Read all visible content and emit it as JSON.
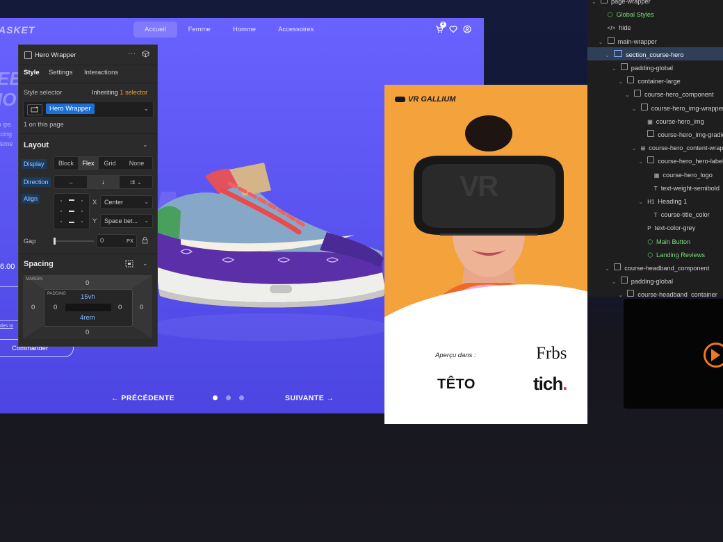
{
  "site": {
    "logo": "ASKET",
    "nav": [
      "Accueil",
      "Femme",
      "Homme",
      "Accessoires"
    ],
    "cart_count": "2",
    "bg_word": "MA",
    "side_title": [
      "EE",
      "IO"
    ],
    "side_text": [
      "m ips",
      "iscing",
      "eleme"
    ],
    "price": "6.00",
    "sizes_link": "des ta",
    "order_button": "Commander",
    "prev_label": "PRÉCÉDENTE",
    "next_label": "SUIVANTE",
    "colors": {
      "bg": "#5c55f2",
      "accent": "#ffffff"
    }
  },
  "style_panel": {
    "element_name": "Hero Wrapper",
    "tabs": [
      "Style",
      "Settings",
      "Interactions"
    ],
    "style_selector_label": "Style selector",
    "inheriting_label": "Inheriting",
    "inheriting_count": "1 selector",
    "selector_chip": "Hero Wrapper",
    "on_page": "1 on this page",
    "layout_title": "Layout",
    "display_label": "Display",
    "display_options": [
      "Block",
      "Flex",
      "Grid",
      "None"
    ],
    "display_selected": "Flex",
    "direction_label": "Direction",
    "align_label": "Align",
    "x_label": "X",
    "x_value": "Center",
    "y_label": "Y",
    "y_value": "Space bet...",
    "gap_label": "Gap",
    "gap_value": "0",
    "gap_unit": "PX",
    "spacing_title": "Spacing",
    "margin_label": "MARGIN",
    "padding_label": "PADDING",
    "margin": {
      "top": "0",
      "right": "0",
      "bottom": "0",
      "left": "0"
    },
    "padding": {
      "top": "15vh",
      "right": "0",
      "bottom": "4rem",
      "left": "0"
    }
  },
  "vr_card": {
    "brand": "VR GALLIUM",
    "headset_text": "VR",
    "apercu": "Aperçu dans :",
    "logos": [
      "Frbs",
      "TÊTO",
      "tich"
    ],
    "logo_dot": ".",
    "colors": {
      "orange": "#f3a23c",
      "dot": "#e84040"
    }
  },
  "navigator": {
    "items": [
      {
        "label": "page-wrapper",
        "indent": 0,
        "icon": "box",
        "chev": true
      },
      {
        "label": "Global Styles",
        "indent": 1,
        "icon": "cube",
        "chev": false,
        "green": true
      },
      {
        "label": "hide",
        "indent": 1,
        "icon": "embed",
        "chev": false
      },
      {
        "label": "main-wrapper",
        "indent": 1,
        "icon": "box",
        "chev": true
      },
      {
        "label": "section_course-hero",
        "indent": 2,
        "icon": "section",
        "chev": true,
        "selected": true
      },
      {
        "label": "padding-global",
        "indent": 3,
        "icon": "box",
        "chev": true
      },
      {
        "label": "container-large",
        "indent": 4,
        "icon": "box",
        "chev": true
      },
      {
        "label": "course-hero_component",
        "indent": 5,
        "icon": "box",
        "chev": true
      },
      {
        "label": "course-hero_img-wrapper",
        "indent": 6,
        "icon": "box",
        "chev": true
      },
      {
        "label": "course-hero_img",
        "indent": 7,
        "icon": "image",
        "chev": false
      },
      {
        "label": "course-hero_img-gradient",
        "indent": 7,
        "icon": "box",
        "chev": false
      },
      {
        "label": "course-hero_content-wrapper",
        "indent": 6,
        "icon": "grid",
        "chev": true
      },
      {
        "label": "course-hero_hero-label",
        "indent": 7,
        "icon": "box",
        "chev": true
      },
      {
        "label": "course-hero_logo",
        "indent": 8,
        "icon": "image",
        "chev": false
      },
      {
        "label": "text-weight-semibold",
        "indent": 8,
        "icon": "text",
        "chev": false
      },
      {
        "label": "Heading 1",
        "indent": 7,
        "icon": "h1",
        "chev": true
      },
      {
        "label": "course-title_color",
        "indent": 8,
        "icon": "text",
        "chev": false
      },
      {
        "label": "text-color-grey",
        "indent": 7,
        "icon": "para",
        "chev": false
      },
      {
        "label": "Main Button",
        "indent": 7,
        "icon": "cube",
        "chev": false,
        "green": true
      },
      {
        "label": "Landing Reviews",
        "indent": 7,
        "icon": "cube",
        "chev": false,
        "green": true
      },
      {
        "label": "course-headband_component",
        "indent": 2,
        "icon": "box",
        "chev": true
      },
      {
        "label": "padding-global",
        "indent": 3,
        "icon": "box",
        "chev": true
      },
      {
        "label": "course-headband_container",
        "indent": 4,
        "icon": "box",
        "chev": true
      }
    ]
  }
}
